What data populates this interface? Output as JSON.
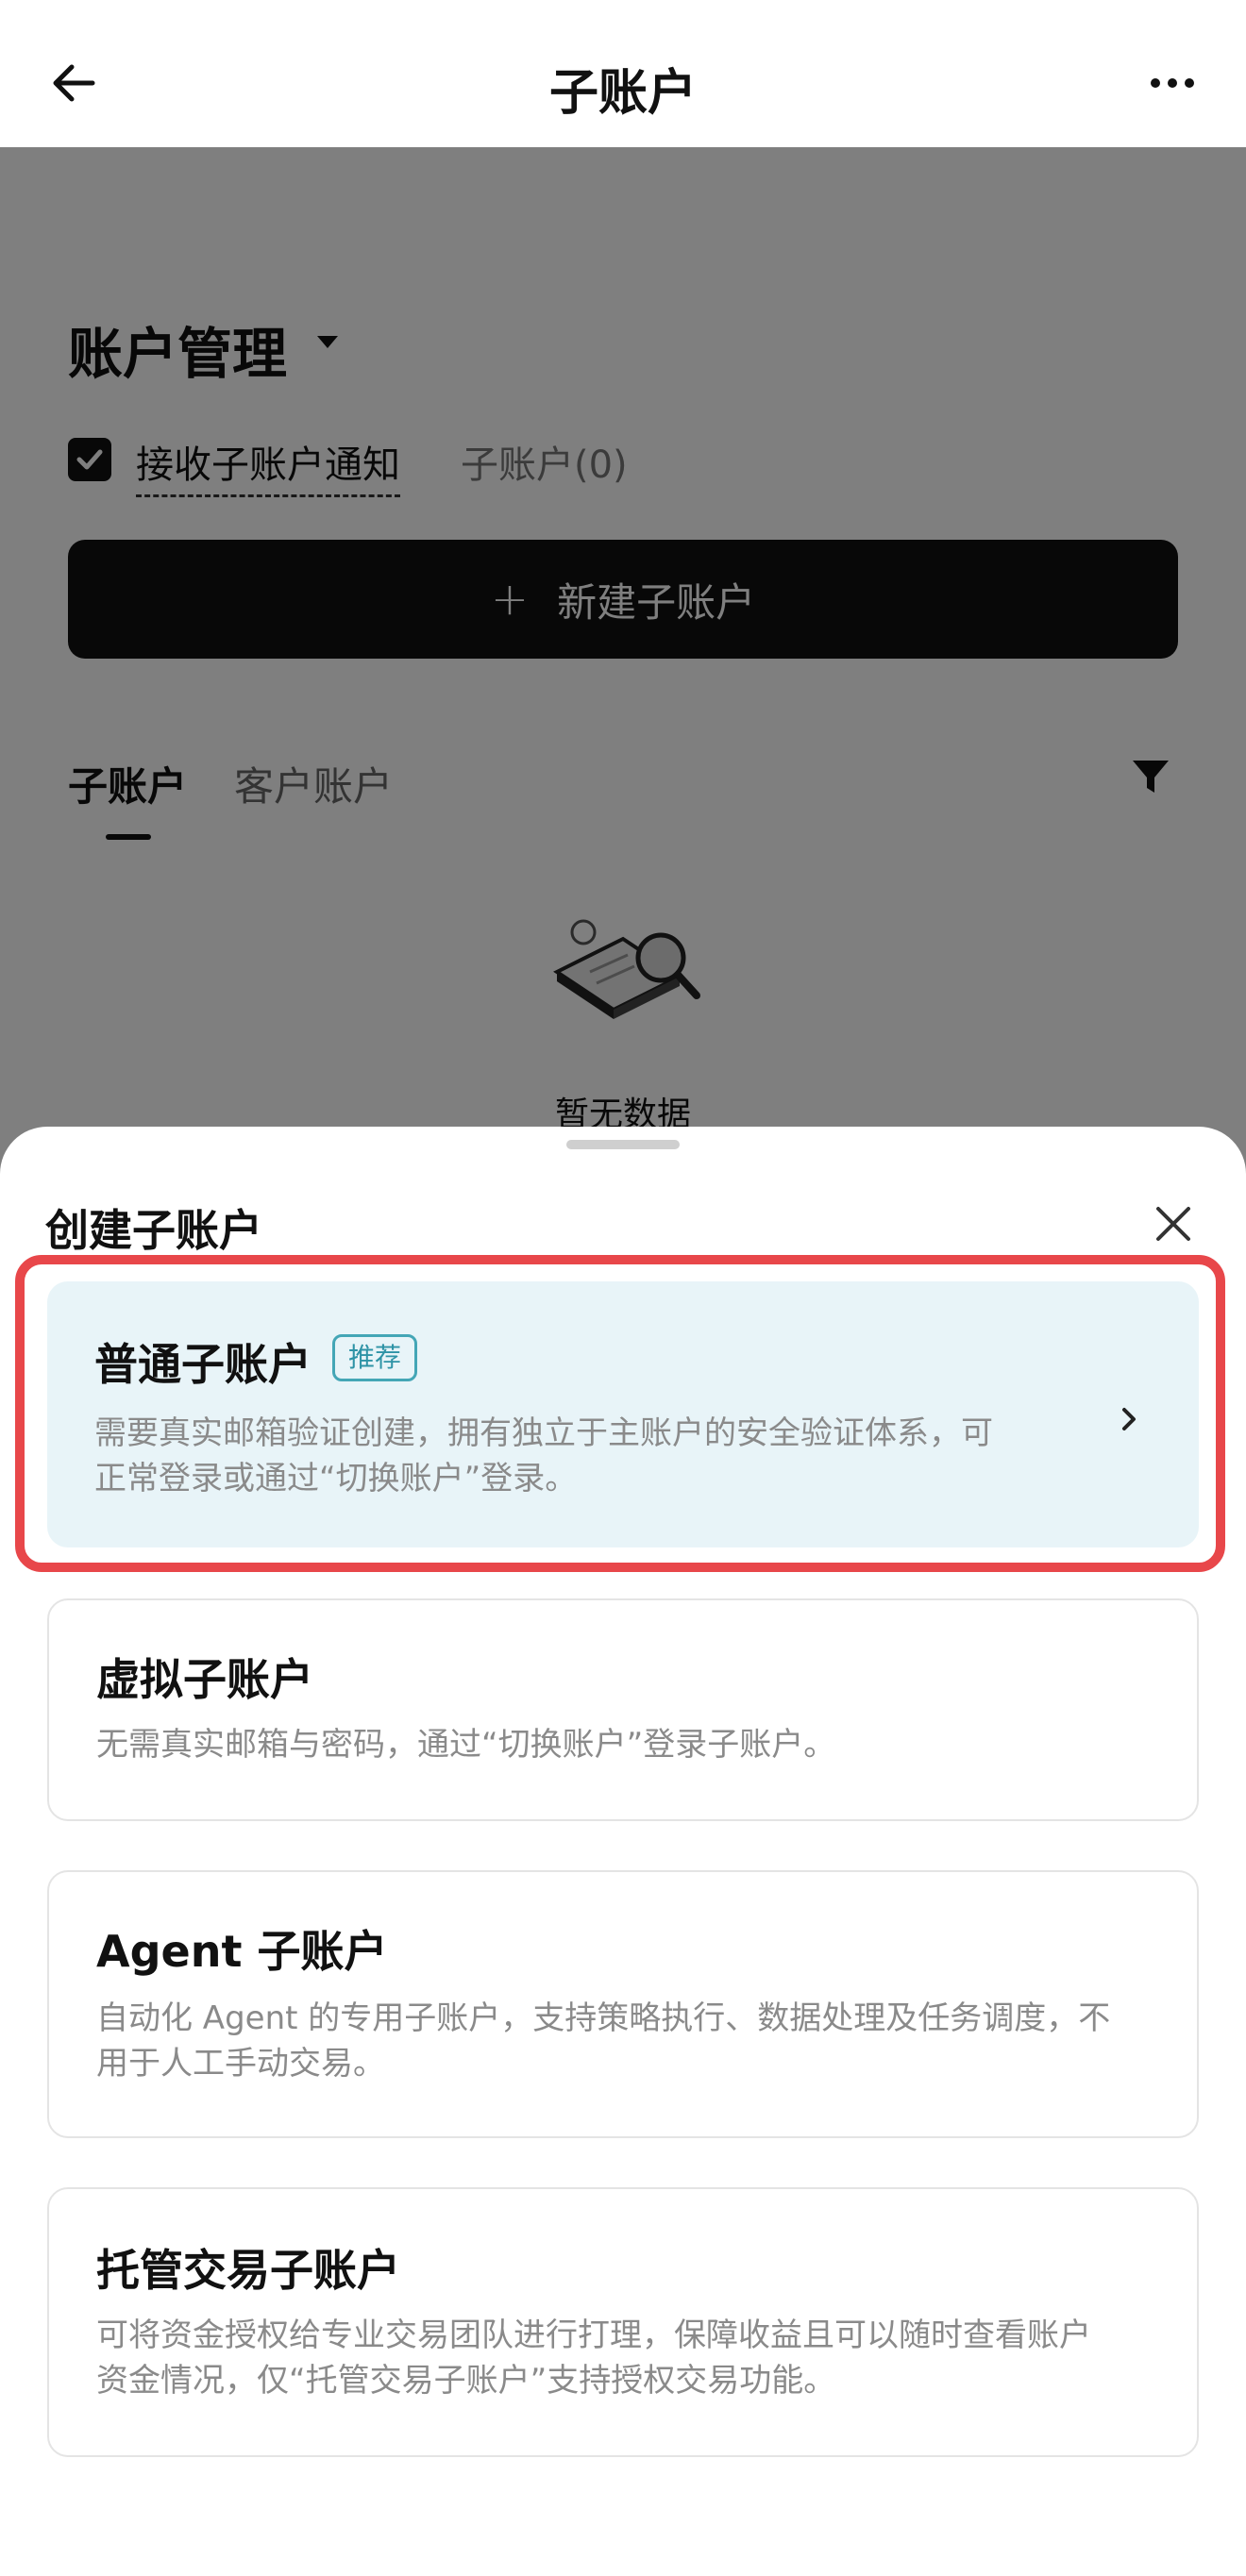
{
  "header": {
    "title": "子账户"
  },
  "account": {
    "section_title": "账户管理",
    "notify_label": "接收子账户通知",
    "sub_count": "子账户(0)",
    "new_button_label": "新建子账户",
    "tabs": [
      "子账户",
      "客户账户"
    ],
    "empty_text": "暂无数据"
  },
  "sheet": {
    "title": "创建子账户",
    "options": [
      {
        "title": "普通子账户",
        "badge": "推荐",
        "line1": "需要真实邮箱验证创建，拥有独立于主账户的安全验证体系，可",
        "line2": "正常登录或通过“切换账户”登录。"
      },
      {
        "title": "虚拟子账户",
        "line1": "无需真实邮箱与密码，通过“切换账户”登录子账户。"
      },
      {
        "title": "Agent 子账户",
        "line1": "自动化 Agent 的专用子账户，支持策略执行、数据处理及任务调度，不",
        "line2": "用于人工手动交易。"
      },
      {
        "title": "托管交易子账户",
        "line1": "可将资金授权给专业交易团队进行打理，保障收益且可以随时查看账户",
        "line2": "资金情况，仅“托管交易子账户”支持授权交易功能。"
      }
    ]
  },
  "colors": {
    "highlight_border": "#e8474a",
    "recommended_card_bg": "#e8f4f8",
    "badge": "#2e93a6"
  }
}
